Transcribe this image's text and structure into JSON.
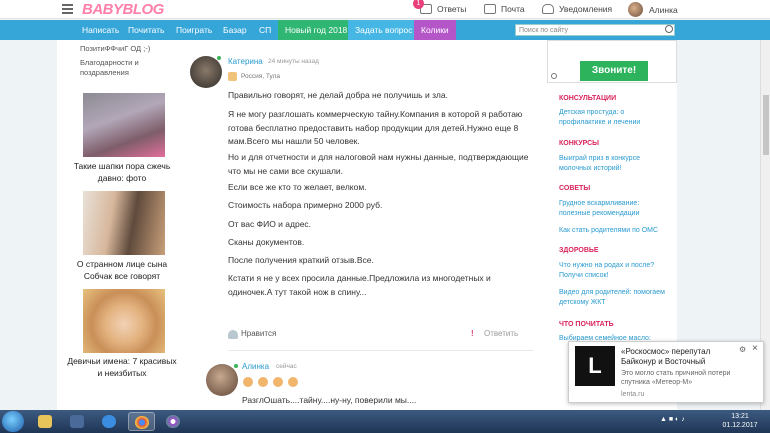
{
  "header": {
    "logo_main": "BABY",
    "logo_accent": "BLOG",
    "answers": "Ответы",
    "answers_badge": "1",
    "mail": "Почта",
    "notifications": "Уведомления",
    "user": "Алинка"
  },
  "mainnav": {
    "items": [
      "Написать",
      "Почитать",
      "Поиграть",
      "Базар",
      "СП"
    ],
    "new_year": "Новый год 2018",
    "ask": "Задать вопрос",
    "koliki": "Колики",
    "search_placeholder": "Поиск по сайту"
  },
  "left": {
    "top_link1": "ПозитиФФчиГ ОД ;-)",
    "top_link2": "Благодарности и поздравления",
    "cards": [
      {
        "caption": "Такие шапки пора сжечь давно: фото"
      },
      {
        "caption": "О странном лице сына Собчак все говорят"
      },
      {
        "caption": "Девичьи имена: 7 красивых и неизбитых"
      }
    ]
  },
  "post": {
    "author": "Катерина",
    "time": "24 минуты назад",
    "location": "Россия, Тула",
    "paragraphs": [
      "Правильно говорят, не делай добра не получишь и зла.",
      "Я не могу разглошать коммерческую тайну.Компания в которой я работаю готова бесплатно предоставить набор продукции для детей.Нужно еще 8 мам.Всего мы нашли 50 человек.",
      "Но и для отчетности и для налоговой нам нужны данные, подтверждающие что мы не сами все скушали.",
      "Если все же кто то желает, велком.",
      "Стоимость набора примерно 2000 руб.",
      "От вас ФИО и адрес.",
      "Сканы документов.",
      "После получения краткий отзыв.Все.",
      "Кстати я не у всех просила данные.Предложила из многодетных и одиночек.А тут такой нож в спину..."
    ],
    "like": "Нравится",
    "report": "!",
    "reply": "Ответить"
  },
  "reply": {
    "author": "Алинка",
    "time": "сейчас",
    "text": "РазглОшать....тайну....ну-ну, поверили мы...."
  },
  "right": {
    "ad_button": "Звоните!",
    "sections": [
      {
        "title": "КОНСУЛЬТАЦИИ",
        "links": [
          "Детская простуда: о профилактике и лечении"
        ]
      },
      {
        "title": "КОНКУРСЫ",
        "links": [
          "Выиграй приз в конкурсе молочных историй!"
        ]
      },
      {
        "title": "СОВЕТЫ",
        "links": [
          "Грудное вскармливание: полезные рекомендации",
          "Как стать родителями по ОМС"
        ]
      },
      {
        "title": "ЗДОРОВЬЕ",
        "links": [
          "Что нужно на родах и после? Получи список!",
          "Видео для родителей: помогаем детскому ЖКТ"
        ]
      },
      {
        "title": "ЧТО ПОЧИТАТЬ",
        "links": [
          "Выбираем семейное масло:"
        ]
      }
    ]
  },
  "toast": {
    "logo": "L",
    "title": "«Роскосмос» перепутал Байконур и Восточный",
    "body": "Это могло стать причиной потери спутника «Метеор-М»",
    "source": "lenta.ru"
  },
  "taskbar": {
    "time": "13:21",
    "date": "01.12.2017"
  }
}
